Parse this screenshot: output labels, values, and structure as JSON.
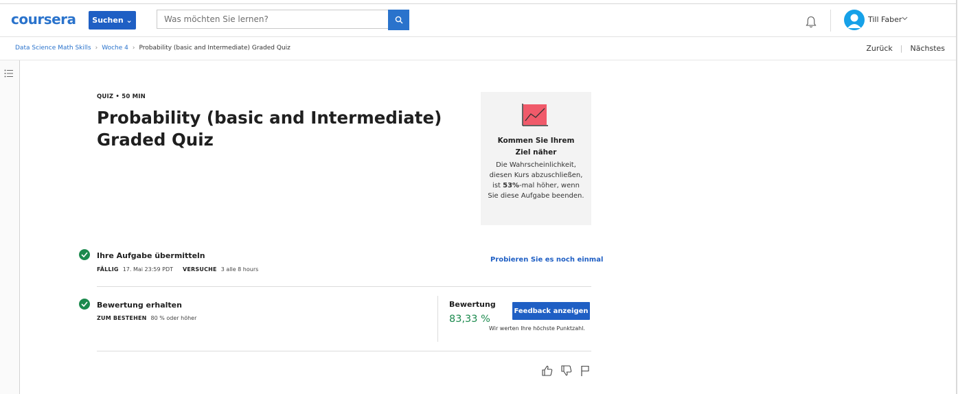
{
  "header": {
    "logo_text": "coursera",
    "search_button_label": "Suchen ⌄",
    "search_placeholder": "Was möchten Sie lernen?",
    "user_name": "Till Faber"
  },
  "breadcrumb": {
    "items": [
      "Data Science Math Skills",
      "Woche 4"
    ],
    "current": "Probability (basic and Intermediate) Graded Quiz"
  },
  "nav": {
    "back": "Zurück",
    "next": "Nächstes",
    "separator": "|"
  },
  "quiz": {
    "meta": "QUIZ • 50 MIN",
    "title": "Probability (basic and Intermediate) Graded Quiz"
  },
  "goal_card": {
    "heading": "Kommen Sie Ihrem Ziel näher",
    "body_pre": "Die Wahrscheinlichkeit, diesen Kurs abzuschließen, ist ",
    "body_bold": "53%",
    "body_post": "-mal höher, wenn Sie diese Aufgabe beenden."
  },
  "submit": {
    "title": "Ihre Aufgabe übermitteln",
    "due_label": "FÄLLIG",
    "due_value": "17. Mai 23:59 PDT",
    "attempts_label": "VERSUCHE",
    "attempts_value": "3 alle 8 hours",
    "retry_link": "Probieren Sie es noch einmal"
  },
  "grade": {
    "title": "Bewertung erhalten",
    "pass_label": "ZUM BESTEHEN",
    "pass_value": "80 % oder höher",
    "label": "Bewertung",
    "value": "83,33 %",
    "feedback_button": "Feedback anzeigen",
    "note": "Wir werten Ihre höchste Punktzahl."
  },
  "colors": {
    "brand": "#2a73cc",
    "button": "#1f5fc4",
    "success": "#1c8a4e",
    "goal_chart": "#f05a6a"
  }
}
